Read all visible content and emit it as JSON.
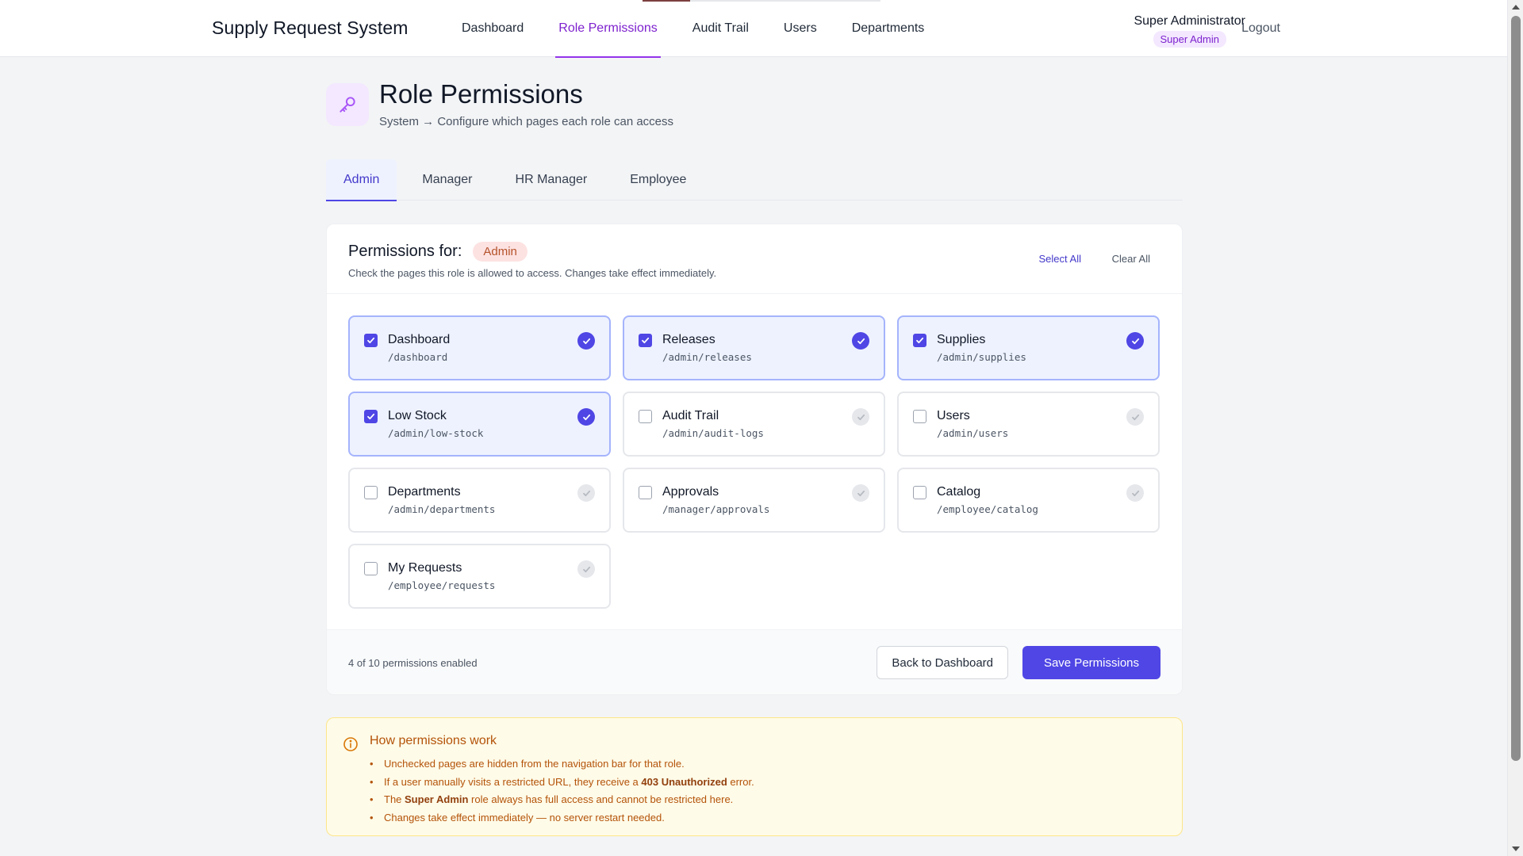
{
  "app": {
    "title": "Supply Request System"
  },
  "nav": {
    "items": [
      {
        "label": "Dashboard",
        "active": false
      },
      {
        "label": "Role Permissions",
        "active": true
      },
      {
        "label": "Audit Trail",
        "active": false
      },
      {
        "label": "Users",
        "active": false
      },
      {
        "label": "Departments",
        "active": false
      }
    ],
    "user_name": "Super Administrator",
    "user_role": "Super Admin",
    "logout_label": "Logout"
  },
  "page": {
    "icon": "key-icon",
    "title": "Role Permissions",
    "subtitle": "System → Configure which pages each role can access"
  },
  "tabs": [
    {
      "label": "Admin",
      "active": true
    },
    {
      "label": "Manager",
      "active": false
    },
    {
      "label": "HR Manager",
      "active": false
    },
    {
      "label": "Employee",
      "active": false
    }
  ],
  "permissions": {
    "heading": "Permissions for:",
    "role": "Admin",
    "description": "Check the pages this role is allowed to access. Changes take effect immediately.",
    "select_all_label": "Select All",
    "clear_all_label": "Clear All",
    "items": [
      {
        "name": "Dashboard",
        "path": "/dashboard",
        "checked": true
      },
      {
        "name": "Releases",
        "path": "/admin/releases",
        "checked": true
      },
      {
        "name": "Supplies",
        "path": "/admin/supplies",
        "checked": true
      },
      {
        "name": "Low Stock",
        "path": "/admin/low-stock",
        "checked": true
      },
      {
        "name": "Audit Trail",
        "path": "/admin/audit-logs",
        "checked": false
      },
      {
        "name": "Users",
        "path": "/admin/users",
        "checked": false
      },
      {
        "name": "Departments",
        "path": "/admin/departments",
        "checked": false
      },
      {
        "name": "Approvals",
        "path": "/manager/approvals",
        "checked": false
      },
      {
        "name": "Catalog",
        "path": "/employee/catalog",
        "checked": false
      },
      {
        "name": "My Requests",
        "path": "/employee/requests",
        "checked": false
      }
    ],
    "count_text": "4 of 10 permissions enabled",
    "back_label": "Back to Dashboard",
    "save_label": "Save Permissions"
  },
  "info": {
    "title": "How permissions work",
    "lines": [
      {
        "pre": "Unchecked pages are hidden from the navigation bar for that role.",
        "bold": "",
        "post": ""
      },
      {
        "pre": "If a user manually visits a restricted URL, they receive a ",
        "bold": "403 Unauthorized",
        "post": " error."
      },
      {
        "pre": "The ",
        "bold": "Super Admin",
        "post": " role always has full access and cannot be restricted here."
      },
      {
        "pre": "Changes take effect immediately — no server restart needed.",
        "bold": "",
        "post": ""
      }
    ]
  },
  "colors": {
    "accent": "#4f46e5",
    "nav_active": "#7e22ce",
    "role_badge_bg": "#fde2e2",
    "info_text": "#b45309"
  }
}
